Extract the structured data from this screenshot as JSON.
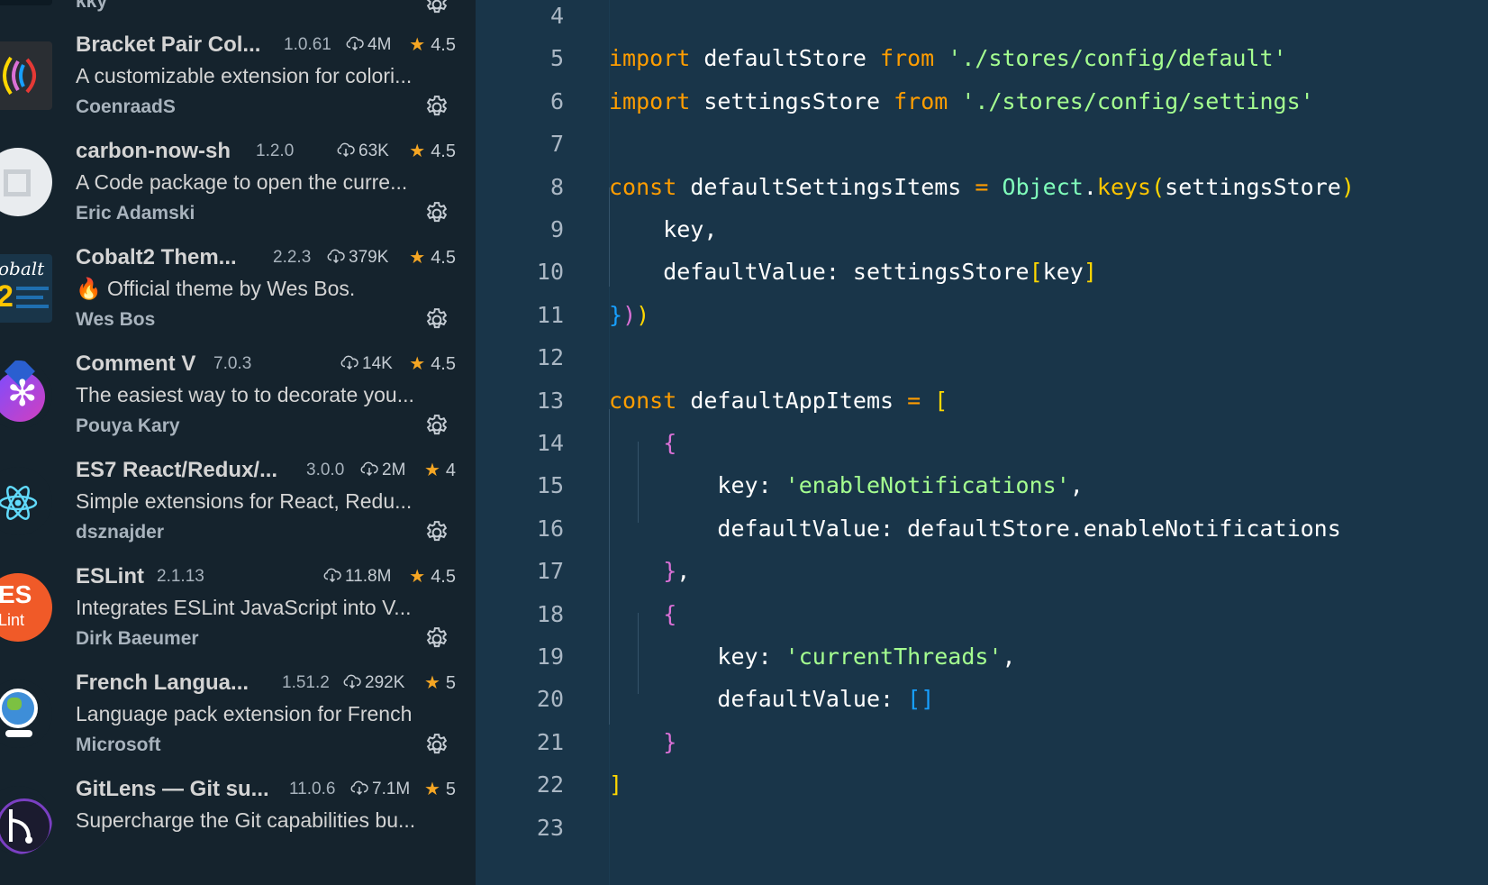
{
  "extensions": [
    {
      "name": "Bracket Pair Col...",
      "version": "1.0.61",
      "downloads": "4M",
      "rating": "4.5",
      "description": "A customizable extension for colori...",
      "author": "CoenraadS"
    },
    {
      "name": "carbon-now-sh",
      "version": "1.2.0",
      "downloads": "63K",
      "rating": "4.5",
      "description": "A Code package to open the curre...",
      "author": "Eric Adamski"
    },
    {
      "name": "Cobalt2 Them...",
      "version": "2.2.3",
      "downloads": "379K",
      "rating": "4.5",
      "description": "🔥 Official theme by Wes Bos.",
      "author": "Wes Bos"
    },
    {
      "name": "Comment V",
      "version": "7.0.3",
      "downloads": "14K",
      "rating": "4.5",
      "description": "The easiest way to to decorate you...",
      "author": "Pouya Kary"
    },
    {
      "name": "ES7 React/Redux/...",
      "version": "3.0.0",
      "downloads": "2M",
      "rating": "4",
      "description": "Simple extensions for React, Redu...",
      "author": "dsznajder"
    },
    {
      "name": "ESLint",
      "version": "2.1.13",
      "downloads": "11.8M",
      "rating": "4.5",
      "description": "Integrates ESLint JavaScript into V...",
      "author": "Dirk Baeumer"
    },
    {
      "name": "French Langua...",
      "version": "1.51.2",
      "downloads": "292K",
      "rating": "5",
      "description": "Language pack extension for French",
      "author": "Microsoft"
    },
    {
      "name": "GitLens — Git su...",
      "version": "11.0.6",
      "downloads": "7.1M",
      "rating": "5",
      "description": "Supercharge the Git capabilities bu...",
      "author": ""
    }
  ],
  "partial_top_author": "kky",
  "icon_labels": {
    "cobalt": "obalt",
    "cobalt_num": "2",
    "eslint_top": "ES",
    "eslint_bottom": "Lint"
  },
  "editor": {
    "line_numbers": [
      "4",
      "5",
      "6",
      "7",
      "8",
      "9",
      "10",
      "11",
      "12",
      "13",
      "14",
      "15",
      "16",
      "17",
      "18",
      "19",
      "20",
      "21",
      "22",
      "23"
    ],
    "code": {
      "l5": {
        "kw1": "import",
        "id": " defaultStore ",
        "kw2": "from",
        "s": " './stores/config/default'"
      },
      "l6": {
        "kw1": "import",
        "id": " settingsStore ",
        "kw2": "from",
        "s": " './stores/config/settings'"
      },
      "l8": {
        "kw": "const",
        "id": " defaultSettingsItems ",
        "eq": "=",
        "obj": " Object",
        "dot": ".",
        "fn": "keys",
        "p": "(",
        "arg": "settingsStore",
        ")": ")"
      },
      "l9": "key,",
      "l10": {
        "k": "defaultValue: settingsStore",
        "b1": "[",
        "key": "key",
        "b2": "]"
      },
      "l11": {
        "a": "}",
        "b": ")",
        "c": ")"
      },
      "l13": {
        "kw": "const",
        "id": " defaultAppItems ",
        "eq": "=",
        "br": " ["
      },
      "l14": "{",
      "l15": {
        "k": "key: ",
        "s": "'enableNotifications'",
        "c": ","
      },
      "l16": "defaultValue: defaultStore.enableNotifications",
      "l17": {
        "b": "}",
        "c": ","
      },
      "l18": "{",
      "l19": {
        "k": "key: ",
        "s": "'currentThreads'",
        "c": ","
      },
      "l20": {
        "k": "defaultValue: ",
        "b": "[]"
      },
      "l21": "}",
      "l22": "]"
    }
  }
}
